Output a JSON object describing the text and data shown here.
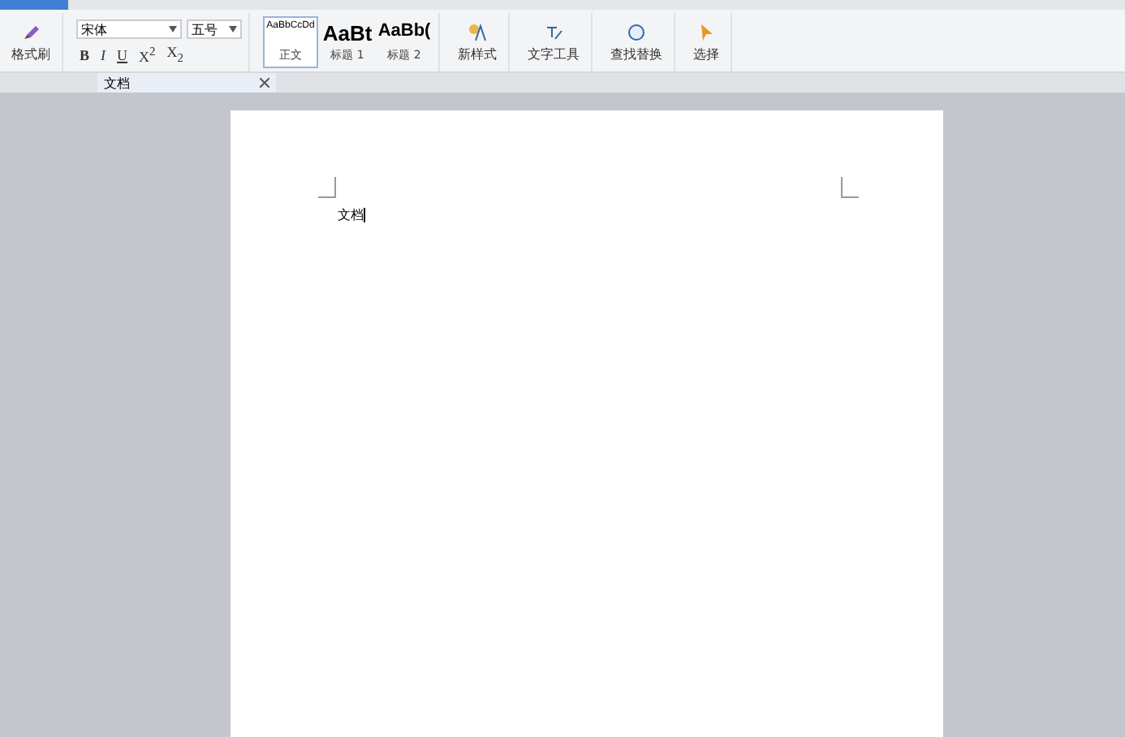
{
  "ribbon": {
    "format_painter": "格式刷",
    "font": {
      "name": "宋体",
      "size": "五号"
    },
    "format_buttons": [
      "B",
      "I",
      "U",
      "X$^{2}$",
      "X$_{2}$"
    ],
    "styles": [
      {
        "sample": "AaBbCcDd",
        "label": "正文",
        "selected": true,
        "kind": "small"
      },
      {
        "sample": "AaBt",
        "label": "标题 1",
        "selected": false,
        "kind": "large"
      },
      {
        "sample": "AaBb(",
        "label": "标题 2",
        "selected": false,
        "kind": "medium"
      }
    ],
    "tools": [
      {
        "label": "新样式",
        "kind": "style"
      },
      {
        "label": "文字工具",
        "kind": "text"
      },
      {
        "label": "查找替换",
        "kind": "find"
      },
      {
        "label": "选择",
        "kind": "select"
      }
    ]
  },
  "doc_tab": {
    "title": "文档"
  },
  "document": {
    "text": "文档"
  }
}
